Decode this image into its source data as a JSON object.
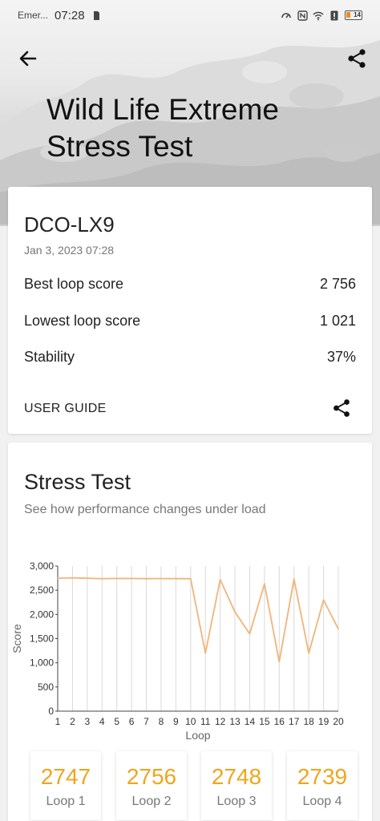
{
  "status_bar": {
    "carrier": "Emer...",
    "time": "07:28",
    "battery": "14"
  },
  "header": {
    "title": "Wild Life Extreme Stress Test"
  },
  "summary": {
    "device": "DCO-LX9",
    "date": "Jan 3, 2023 07:28",
    "rows": [
      {
        "label": "Best loop score",
        "value": "2 756"
      },
      {
        "label": "Lowest loop score",
        "value": "1 021"
      },
      {
        "label": "Stability",
        "value": "37%"
      }
    ],
    "user_guide": "USER GUIDE"
  },
  "stress": {
    "title": "Stress Test",
    "subtitle": "See how performance changes under load"
  },
  "chart_data": {
    "type": "line",
    "xlabel": "Loop",
    "ylabel": "Score",
    "x": [
      1,
      2,
      3,
      4,
      5,
      6,
      7,
      8,
      9,
      10,
      11,
      12,
      13,
      14,
      15,
      16,
      17,
      18,
      19,
      20
    ],
    "y_ticks": [
      "0",
      "500",
      "1,000",
      "1,500",
      "2,000",
      "2,500",
      "3,000"
    ],
    "ylim": [
      0,
      3000
    ],
    "series": [
      {
        "values": [
          2747,
          2756,
          2748,
          2739,
          2745,
          2743,
          2740,
          2741,
          2740,
          2738,
          1200,
          2720,
          2050,
          1600,
          2630,
          1021,
          2730,
          1200,
          2300,
          1700
        ]
      }
    ],
    "line_color": "#f2b47a",
    "grid": "vertical"
  },
  "loops": [
    {
      "value": "2747",
      "label": "Loop 1"
    },
    {
      "value": "2756",
      "label": "Loop 2"
    },
    {
      "value": "2748",
      "label": "Loop 3"
    },
    {
      "value": "2739",
      "label": "Loop 4"
    }
  ]
}
